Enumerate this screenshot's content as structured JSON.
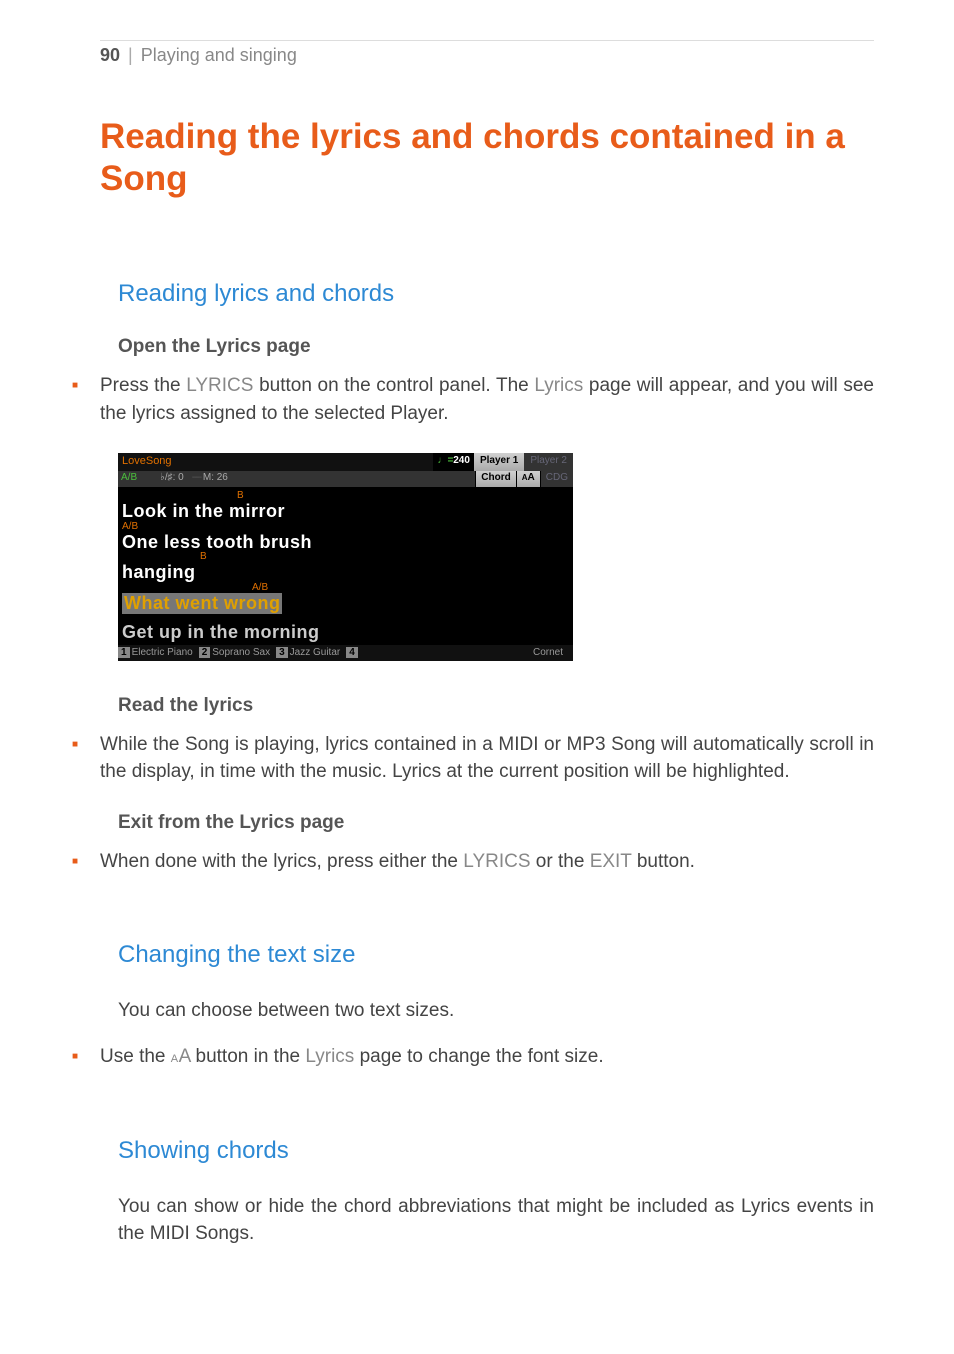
{
  "header": {
    "page_number": "90",
    "divider": "|",
    "section": "Playing and singing"
  },
  "title": "Reading the lyrics and chords contained in a Song",
  "s1": {
    "heading": "Reading lyrics and chords",
    "step1": {
      "label": "Open the Lyrics page",
      "text_a": "Press the ",
      "text_b": " button on the control panel. The ",
      "text_c": " page will appear, and you will see the lyrics assigned to the selected Player.",
      "btn": "LYRICS",
      "page": "Lyrics"
    },
    "step2": {
      "label": "Read the lyrics",
      "text": "While the Song is playing, lyrics contained in a MIDI or MP3 Song will automatically scroll in the display, in time with the music. Lyrics at the current position will be highlighted."
    },
    "step3": {
      "label": "Exit from the Lyrics page",
      "text_a": "When done with the lyrics, press either the ",
      "text_b": " or the ",
      "text_c": " button.",
      "btn1": "LYRICS",
      "btn2": "EXIT"
    }
  },
  "s2": {
    "heading": "Changing the text size",
    "p1": "You can choose between two text sizes.",
    "bullet_a": "Use the ",
    "bullet_b": " button in the ",
    "bullet_c": " page to change the font size.",
    "btn": "AA",
    "page": "Lyrics"
  },
  "s3": {
    "heading": "Showing chords",
    "p1": "You can show or hide the chord abbreviations that might be included as Lyrics events in the MIDI Songs."
  },
  "screen": {
    "title": "LoveSong",
    "tempo_prefix": "♩=",
    "tempo": "240",
    "tab1": "Player 1",
    "tab2": "Player 2",
    "info_chord": "A/B",
    "info_key": "♭/♯: 0",
    "info_meas_prefix": "---- ",
    "info_meas": "M: 26",
    "btn_chord": "Chord",
    "btn_aa": "AA",
    "btn_cdg": "CDG",
    "lines": {
      "c1": "B",
      "l1": "Look in the mirror",
      "c2": "A/B",
      "l2": "One less tooth brush",
      "c3": "B",
      "l3": "hanging",
      "c4": "A/B",
      "l4": "What went wrong",
      "l5": "Get up in the morning"
    },
    "footer": {
      "n1": "1",
      "v1": "Electric Piano",
      "n2": "2",
      "v2": "Soprano Sax",
      "n3": "3",
      "v3": "Jazz Guitar",
      "n4": "4",
      "v4": "",
      "v5": "Cornet"
    }
  }
}
